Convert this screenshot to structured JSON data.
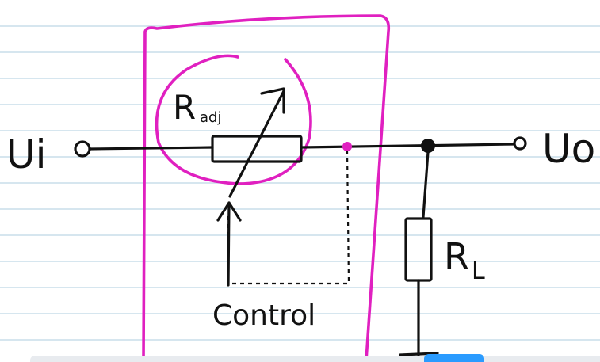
{
  "labels": {
    "input": "Ui",
    "output": "Uo",
    "r_adj": "R",
    "r_adj_sub": "adj",
    "r_load": "R",
    "r_load_sub": "L",
    "control": "Control"
  },
  "colors": {
    "ink": "#111111",
    "highlight": "#e020c0",
    "ruled_lines": "#c9ddea",
    "player_bar": "#e8ebef",
    "player_button": "#2a9bff"
  }
}
